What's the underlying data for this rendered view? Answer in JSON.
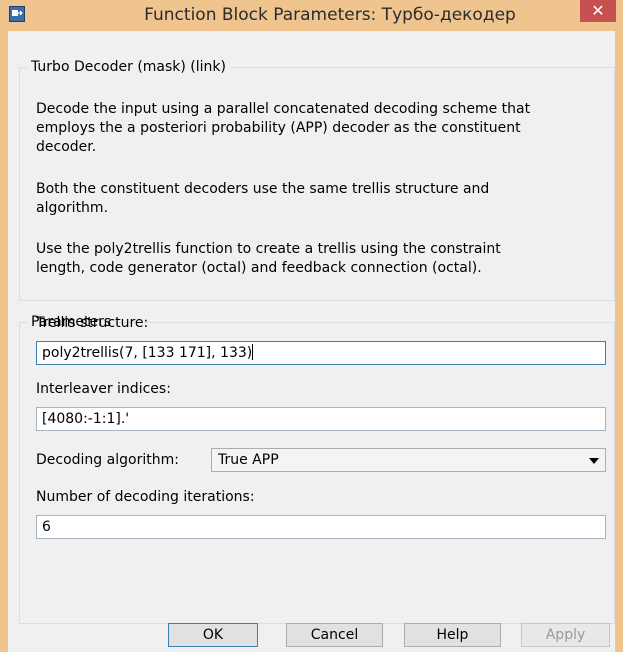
{
  "window": {
    "title": "Function Block Parameters: Турбо-декодер",
    "close_label": "✕",
    "title_icon": "block-parameters-icon",
    "frame_color": "#f0c48f",
    "close_color": "#c75050"
  },
  "description": {
    "group_label": "Turbo Decoder (mask) (link)",
    "paragraphs": [
      [
        "Decode the input using a parallel concatenated decoding scheme that",
        "employs the a posteriori probability (APP) decoder as the constituent",
        "decoder."
      ],
      [
        "Both the constituent decoders use the same trellis structure and",
        "algorithm."
      ],
      [
        "Use the poly2trellis function to create a trellis using the constraint",
        "length, code generator (octal) and feedback connection (octal)."
      ]
    ]
  },
  "parameters": {
    "group_label": "Parameters",
    "trellis_label": "Trellis structure:",
    "trellis_value": "poly2trellis(7, [133 171], 133)",
    "interleaver_label": "Interleaver indices:",
    "interleaver_value": "[4080:-1:1].'",
    "algorithm_label": "Decoding algorithm:",
    "algorithm_value": "True APP",
    "iterations_label": "Number of decoding iterations:",
    "iterations_value": "6"
  },
  "buttons": {
    "ok": "OK",
    "cancel": "Cancel",
    "help": "Help",
    "apply": "Apply"
  }
}
